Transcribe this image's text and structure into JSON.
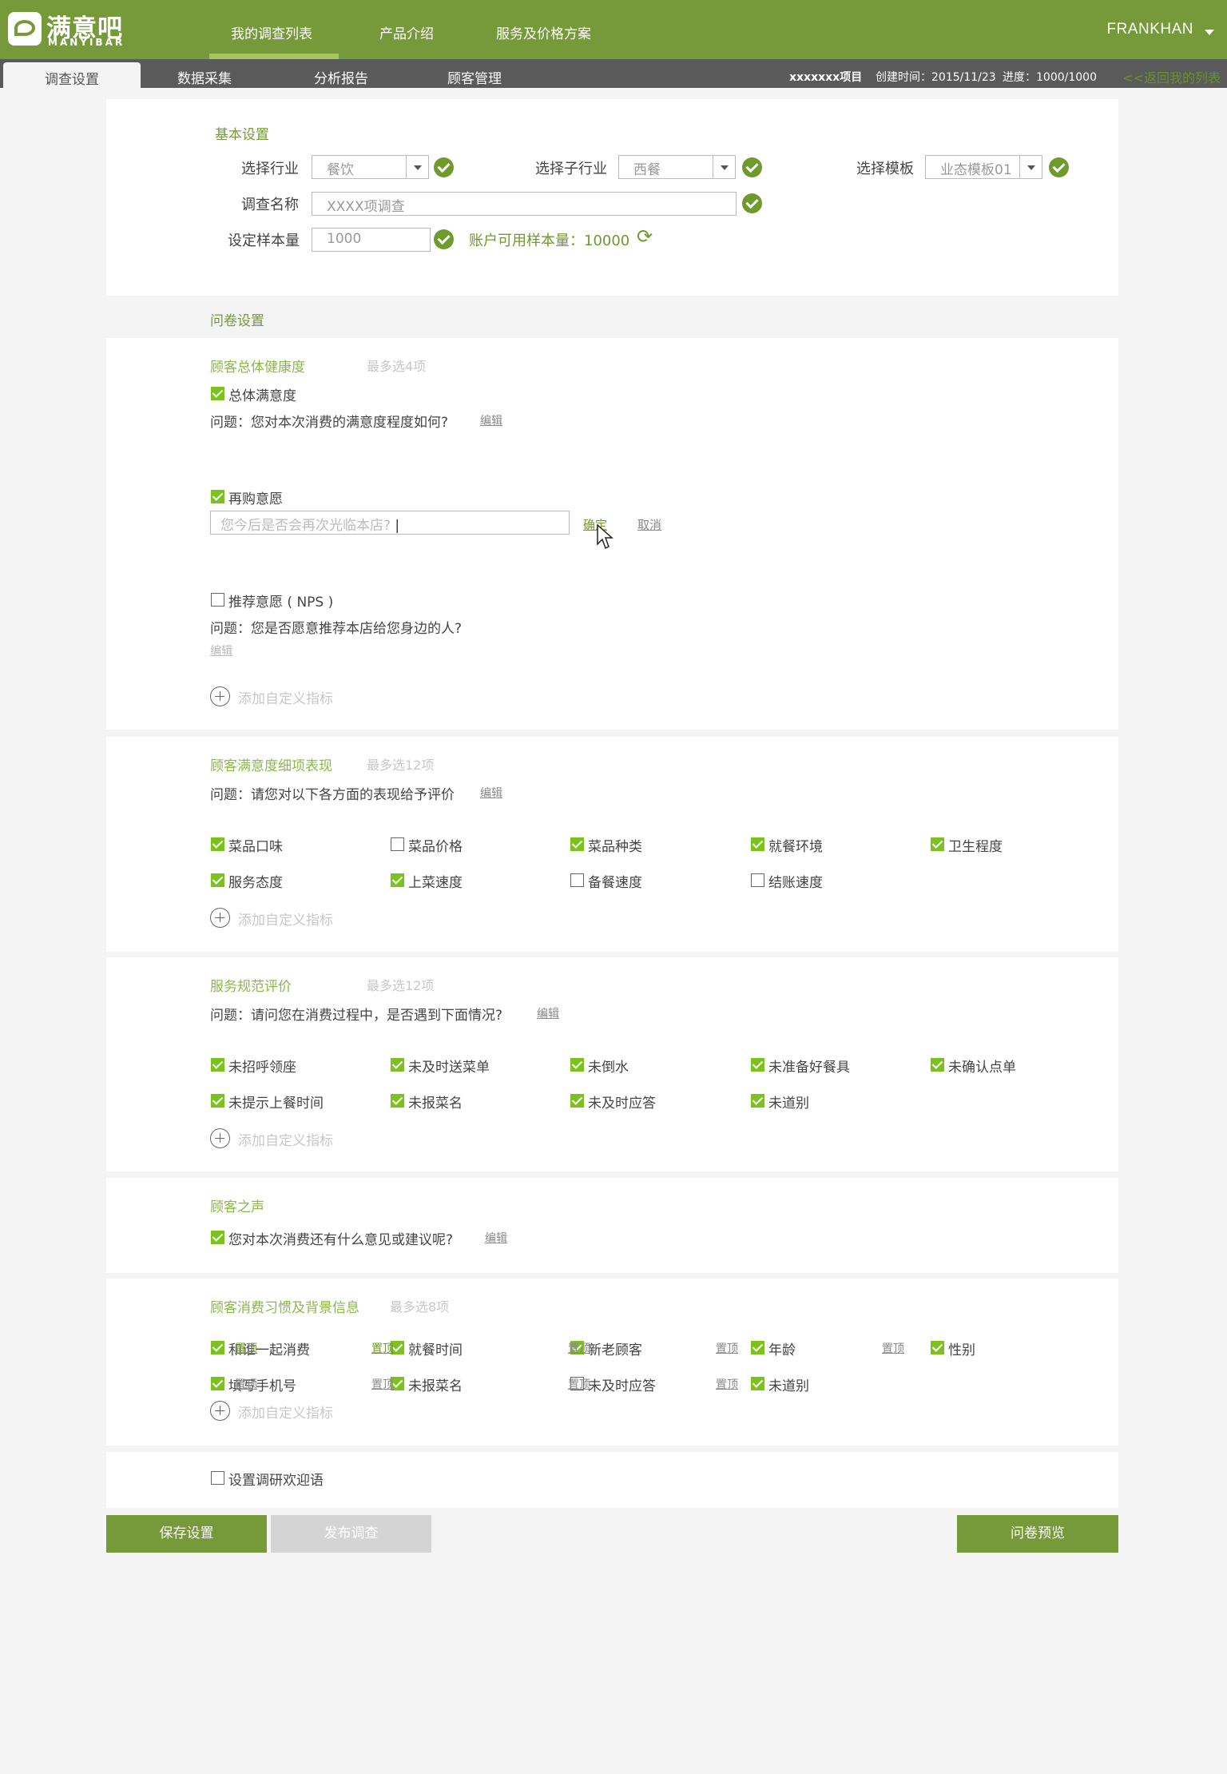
{
  "brand": {
    "name_cn": "满意吧",
    "name_en": "MANYIBAR"
  },
  "nav": {
    "items": [
      "我的调查列表",
      "产品介绍",
      "服务及价格方案"
    ],
    "user": "FRANKHAN"
  },
  "subnav": {
    "tabs": [
      "调查设置",
      "数据采集",
      "分析报告",
      "顾客管理"
    ],
    "project": "xxxxxxx项目",
    "created": "创建时间：2015/11/23",
    "progress": "进度：1000/1000",
    "back": "<<返回我的列表"
  },
  "basic": {
    "title": "基本设置",
    "industry_label": "选择行业",
    "industry_value": "餐饮",
    "sub_industry_label": "选择子行业",
    "sub_industry_value": "西餐",
    "template_label": "选择模板",
    "template_value": "业态模板01",
    "name_label": "调查名称",
    "name_placeholder": "XXXX项调查",
    "sample_label": "设定样本量",
    "sample_value": "1000",
    "available": "账户可用样本量：10000"
  },
  "questionnaire_title": "问卷设置",
  "health": {
    "title": "顾客总体健康度",
    "hint": "最多选4项",
    "overall": {
      "label": "总体满意度",
      "checked": true,
      "question": "问题：您对本次消费的满意度程度如何?",
      "edit": "编辑"
    },
    "repurchase": {
      "label": "再购意愿",
      "checked": true,
      "placeholder": "您今后是否会再次光临本店?",
      "confirm": "确定",
      "cancel": "取消"
    },
    "nps": {
      "label": "推荐意愿 ( NPS )",
      "checked": false,
      "question": "问题：您是否愿意推荐本店给您身边的人?",
      "edit": "编辑"
    },
    "add": "添加自定义指标"
  },
  "detail": {
    "title": "顾客满意度细项表现",
    "hint": "最多选12项",
    "question": "问题：请您对以下各方面的表现给予评价",
    "edit": "编辑",
    "items": [
      {
        "label": "菜品口味",
        "checked": true
      },
      {
        "label": "菜品价格",
        "checked": false
      },
      {
        "label": "菜品种类",
        "checked": true
      },
      {
        "label": "就餐环境",
        "checked": true
      },
      {
        "label": "卫生程度",
        "checked": true
      },
      {
        "label": "服务态度",
        "checked": true
      },
      {
        "label": "上菜速度",
        "checked": true
      },
      {
        "label": "备餐速度",
        "checked": false
      },
      {
        "label": "结账速度",
        "checked": false
      }
    ],
    "add": "添加自定义指标"
  },
  "service": {
    "title": "服务规范评价",
    "hint": "最多选12项",
    "question": "问题：请问您在消费过程中，是否遇到下面情况?",
    "edit": "编辑",
    "items": [
      {
        "label": "未招呼领座",
        "checked": true
      },
      {
        "label": "未及时送菜单",
        "checked": true
      },
      {
        "label": "未倒水",
        "checked": true
      },
      {
        "label": "未准备好餐具",
        "checked": true
      },
      {
        "label": "未确认点单",
        "checked": true
      },
      {
        "label": "未提示上餐时间",
        "checked": true
      },
      {
        "label": "未报菜名",
        "checked": true
      },
      {
        "label": "未及时应答",
        "checked": true
      },
      {
        "label": "未道别",
        "checked": true
      }
    ],
    "add": "添加自定义指标"
  },
  "voice": {
    "title": "顾客之声",
    "item": {
      "label": "您对本次消费还有什么意见或建议呢?",
      "checked": true
    },
    "edit": "编辑"
  },
  "habits": {
    "title": "顾客消费习惯及背景信息",
    "hint": "最多选8项",
    "pin": "置顶",
    "items": [
      {
        "label": "和谁一起消费",
        "checked": true,
        "pin_active": true
      },
      {
        "label": "就餐时间",
        "checked": true,
        "pin_active": true
      },
      {
        "label": "新老顾客",
        "checked": true,
        "pin_active": false
      },
      {
        "label": "年龄",
        "checked": true,
        "pin_active": false
      },
      {
        "label": "性别",
        "checked": true,
        "pin_active": false
      },
      {
        "label": "填写手机号",
        "checked": true,
        "pin_active": false
      },
      {
        "label": "未报菜名",
        "checked": true,
        "pin_active": false
      },
      {
        "label": "未及时应答",
        "checked": false,
        "pin_active": false
      },
      {
        "label": "未道别",
        "checked": true,
        "pin_active": false
      }
    ],
    "add": "添加自定义指标"
  },
  "welcome": {
    "label": "设置调研欢迎语",
    "checked": false
  },
  "actions": {
    "save": "保存设置",
    "publish": "发布调查",
    "preview": "问卷预览"
  },
  "colors": {
    "brand": "#76993a",
    "check": "#7cc21f",
    "subnav": "#5a5a5a"
  }
}
